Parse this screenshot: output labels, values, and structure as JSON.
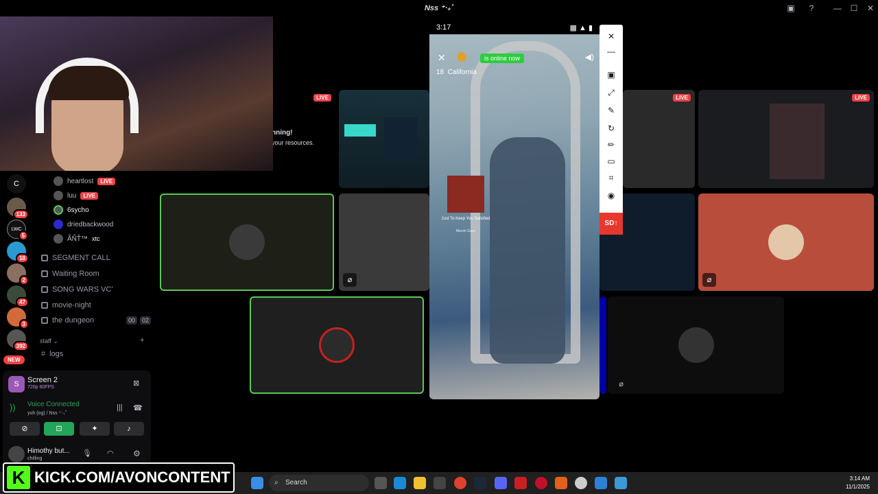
{
  "window": {
    "title": "Nss ⁺‧₊˚",
    "minimize": "—",
    "maximize": "☐",
    "close": "✕"
  },
  "guilds": [
    {
      "label": "C",
      "badge": ""
    },
    {
      "label": "",
      "badge": "133"
    },
    {
      "label": "LWC",
      "badge": "5"
    },
    {
      "label": "",
      "badge": "18"
    },
    {
      "label": "",
      "badge": "2"
    },
    {
      "label": "",
      "badge": "47"
    },
    {
      "label": "",
      "badge": "3"
    },
    {
      "label": "",
      "badge": "392"
    }
  ],
  "new_pill": "NEW",
  "voice_users": [
    {
      "name": "heartlost",
      "live": "LIVE"
    },
    {
      "name": "luu",
      "live": "LIVE"
    },
    {
      "name": "6sycho",
      "live": ""
    },
    {
      "name": "driedbackwood",
      "live": ""
    },
    {
      "name": "ÃÑŤ™",
      "extra": "xtc",
      "live": ""
    }
  ],
  "channels": [
    {
      "name": "SEGMENT CALL"
    },
    {
      "name": "Waiting Room"
    },
    {
      "name": "SONG WARS VC'"
    },
    {
      "name": "movie-night"
    },
    {
      "name": "the dungeon",
      "count_a": "00",
      "count_b": "02"
    }
  ],
  "category": {
    "name": "staff",
    "add": "+"
  },
  "text_channel": {
    "name": "logs"
  },
  "stream_panel": {
    "title": "Screen 2",
    "quality": "720p 60FPS"
  },
  "voice_status": {
    "label": "Voice Connected",
    "sub": "yuh (og) / Nss ⁺‧₊˚"
  },
  "user_panel": {
    "name": "Himothy but...",
    "status": "chilling"
  },
  "partial_text": {
    "line1": "nning!",
    "line2": "your resources."
  },
  "live_label": "LIVE",
  "phone": {
    "time": "3:17",
    "online_text": "is online now",
    "age": "18",
    "location": "California",
    "song_title": "Just To Keep You Satisfied",
    "song_artist": "Marvin Gaye"
  },
  "sidebar_tools": {
    "sd": "SD"
  },
  "taskbar": {
    "search_placeholder": "Search",
    "time": "3:14 AM",
    "date": "11/1/2025"
  },
  "watermark": {
    "logo": "K",
    "text": "KICK.COM/AVONCONTENT"
  },
  "colors": {
    "live": "#ed4245",
    "speaking": "#5ac85a",
    "kick_green": "#53fc18",
    "connected": "#23a55a"
  }
}
